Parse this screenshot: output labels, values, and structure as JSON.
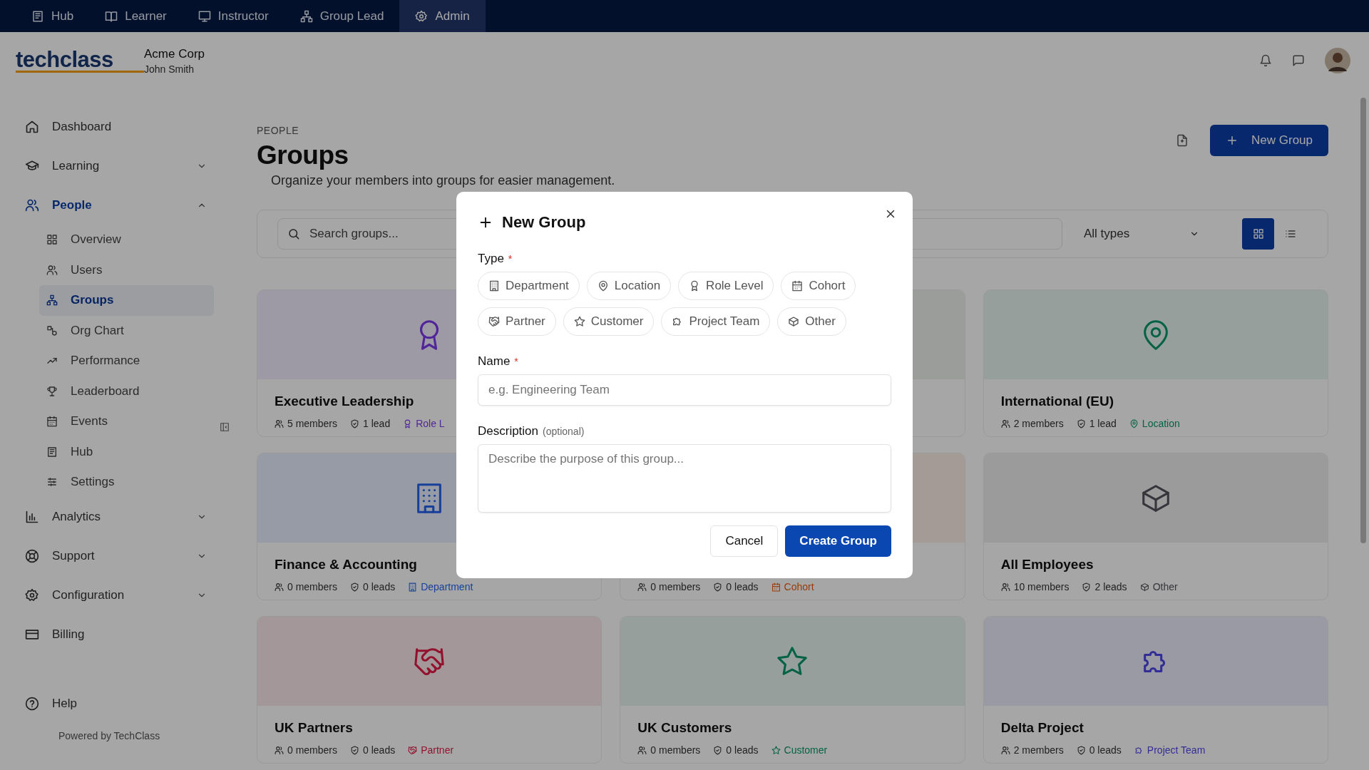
{
  "top_tabs": [
    {
      "label": "Hub",
      "selected": false
    },
    {
      "label": "Learner",
      "selected": false
    },
    {
      "label": "Instructor",
      "selected": false
    },
    {
      "label": "Group Lead",
      "selected": false
    },
    {
      "label": "Admin",
      "selected": true
    }
  ],
  "header": {
    "logo": "techclass",
    "org": "Acme Corp",
    "user": "John Smith"
  },
  "sidebar": {
    "items": [
      {
        "label": "Dashboard",
        "selected": false
      },
      {
        "label": "Learning",
        "selected": false,
        "expanded": false
      },
      {
        "label": "People",
        "selected": true,
        "expanded": true,
        "children": [
          {
            "label": "Overview",
            "selected": false
          },
          {
            "label": "Users",
            "selected": false
          },
          {
            "label": "Groups",
            "selected": true
          },
          {
            "label": "Org Chart",
            "selected": false
          },
          {
            "label": "Performance",
            "selected": false
          },
          {
            "label": "Leaderboard",
            "selected": false
          },
          {
            "label": "Events",
            "selected": false
          },
          {
            "label": "Hub",
            "selected": false
          },
          {
            "label": "Settings",
            "selected": false
          }
        ]
      },
      {
        "label": "Analytics",
        "selected": false,
        "expanded": false
      },
      {
        "label": "Support",
        "selected": false,
        "expanded": false
      },
      {
        "label": "Configuration",
        "selected": false,
        "expanded": false
      },
      {
        "label": "Billing",
        "selected": false
      }
    ],
    "help": "Help",
    "footer": "Powered by TechClass"
  },
  "page": {
    "eyebrow": "PEOPLE",
    "title": "Groups",
    "subtitle": "Organize your members into groups for easier management.",
    "new_button": "New Group"
  },
  "filters": {
    "search_placeholder": "Search groups...",
    "type_select": "All types",
    "grid_view": true
  },
  "cards": [
    {
      "name": "Executive Leadership",
      "members": "5 members",
      "leads": "1 lead",
      "type": "Role L",
      "kind": "role",
      "color": "#51269a"
    },
    {
      "kind": "covered"
    },
    {
      "name": "International (EU)",
      "members": "2 members",
      "leads": "1 lead",
      "type": "Location",
      "kind": "location",
      "color": "#036244"
    },
    {
      "name": "Finance & Accounting",
      "members": "0 members",
      "leads": "0 leads",
      "type": "Department",
      "kind": "department",
      "color": "#184099"
    },
    {
      "members": "0 members",
      "leads": "0 leads",
      "type": "Cohort",
      "kind": "cohort",
      "color": "#983908"
    },
    {
      "name": "All Employees",
      "members": "10 members",
      "leads": "2 leads",
      "type": "Other",
      "kind": "other",
      "color": "#35353b"
    },
    {
      "name": "UK Partners",
      "members": "0 members",
      "leads": "0 leads",
      "type": "Partner",
      "kind": "partner",
      "color": "#92132f"
    },
    {
      "name": "UK Customers",
      "members": "0 members",
      "leads": "0 leads",
      "type": "Customer",
      "kind": "customer",
      "color": "#036244"
    },
    {
      "name": "Delta Project",
      "members": "2 members",
      "leads": "0 leads",
      "type": "Project Team",
      "kind": "team",
      "color": "#332e95"
    }
  ],
  "dialog": {
    "title": "New Group",
    "type_label": "Type",
    "type_mark": "*",
    "types": [
      {
        "label": "Department",
        "kind": "department",
        "selected": false
      },
      {
        "label": "Location",
        "kind": "location",
        "selected": false
      },
      {
        "label": "Role Level",
        "kind": "role",
        "selected": false
      },
      {
        "label": "Cohort",
        "kind": "cohort",
        "selected": false
      },
      {
        "label": "Partner",
        "kind": "partner",
        "selected": false
      },
      {
        "label": "Customer",
        "kind": "customer",
        "selected": false
      },
      {
        "label": "Project Team",
        "kind": "team",
        "selected": false
      },
      {
        "label": "Other",
        "kind": "other",
        "selected": false
      }
    ],
    "name_label": "Name",
    "name_mark": "*",
    "name_placeholder": "e.g. Engineering Team",
    "description_label": "Description",
    "description_note": "(optional)",
    "description_placeholder": "Describe the purpose of this group...",
    "cancel": "Cancel",
    "submit": "Create Group"
  }
}
